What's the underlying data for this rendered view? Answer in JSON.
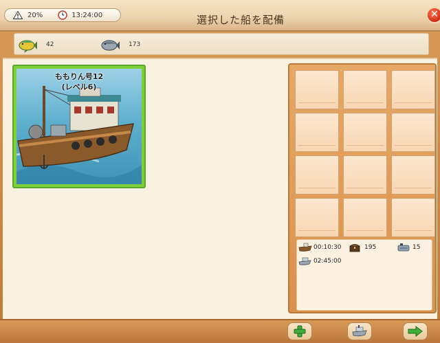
{
  "header": {
    "battery_percent": "20%",
    "time": "13:24:00",
    "title": "選択した船を配備",
    "close_symbol": "✕"
  },
  "resources": [
    {
      "icon": "yellow-fish-icon",
      "count": "42"
    },
    {
      "icon": "gray-fish-icon",
      "count": "173"
    }
  ],
  "ship": {
    "name": "ももりん号12",
    "level": "(レベル6)"
  },
  "slots_count": 12,
  "info": {
    "duration": "00:10:30",
    "chest_count": "195",
    "fuel_count": "15",
    "boat_time": "02:45:00"
  },
  "colors": {
    "accent_green": "#7fcf3a",
    "wood": "#c98b4a",
    "close_red": "#d8361b"
  }
}
